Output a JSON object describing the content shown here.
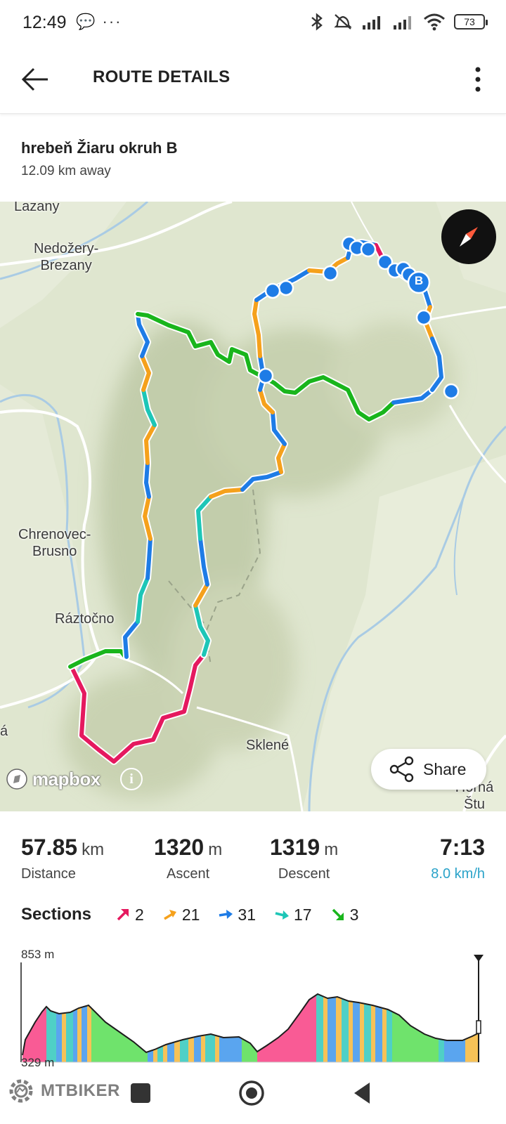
{
  "status_bar": {
    "time": "12:49",
    "left_icons": "💬 ···",
    "battery": "73"
  },
  "app_bar": {
    "title": "ROUTE DETAILS",
    "back_icon": "arrow-left-icon",
    "more_icon": "more-vertical-icon"
  },
  "route": {
    "name": "hrebeň Žiaru okruh B",
    "distance_away": "12.09 km away"
  },
  "map": {
    "places": [
      "Lazany",
      "Nedožery-\nBrezany",
      "Chrenovec-\nBrusno",
      "Ráztočno",
      "Sklené",
      "á",
      "Horná Štu"
    ],
    "end_marker": "B",
    "share_label": "Share",
    "attribution": "mapbox",
    "info_icon": "i"
  },
  "stats": {
    "distance": {
      "value": "57.85",
      "unit": "km",
      "label": "Distance"
    },
    "ascent": {
      "value": "1320",
      "unit": "m",
      "label": "Ascent"
    },
    "descent": {
      "value": "1319",
      "unit": "m",
      "label": "Descent"
    },
    "duration": {
      "value": "7:13",
      "label": "8.0 km/h"
    }
  },
  "sections": {
    "title": "Sections",
    "items": [
      {
        "count": "2",
        "color": "#e5195f",
        "icon": "arrow-up-right-icon"
      },
      {
        "count": "21",
        "color": "#f5a11c",
        "icon": "arrow-up-right-icon"
      },
      {
        "count": "31",
        "color": "#1e7ce6",
        "icon": "arrow-right-icon"
      },
      {
        "count": "17",
        "color": "#1dc6b7",
        "icon": "arrow-right-icon"
      },
      {
        "count": "3",
        "color": "#19b51c",
        "icon": "arrow-down-right-icon"
      }
    ]
  },
  "profile": {
    "max_label": "853 m",
    "min_label": "329 m"
  },
  "nav_bar": {
    "watermark": "MTBIKER"
  }
}
